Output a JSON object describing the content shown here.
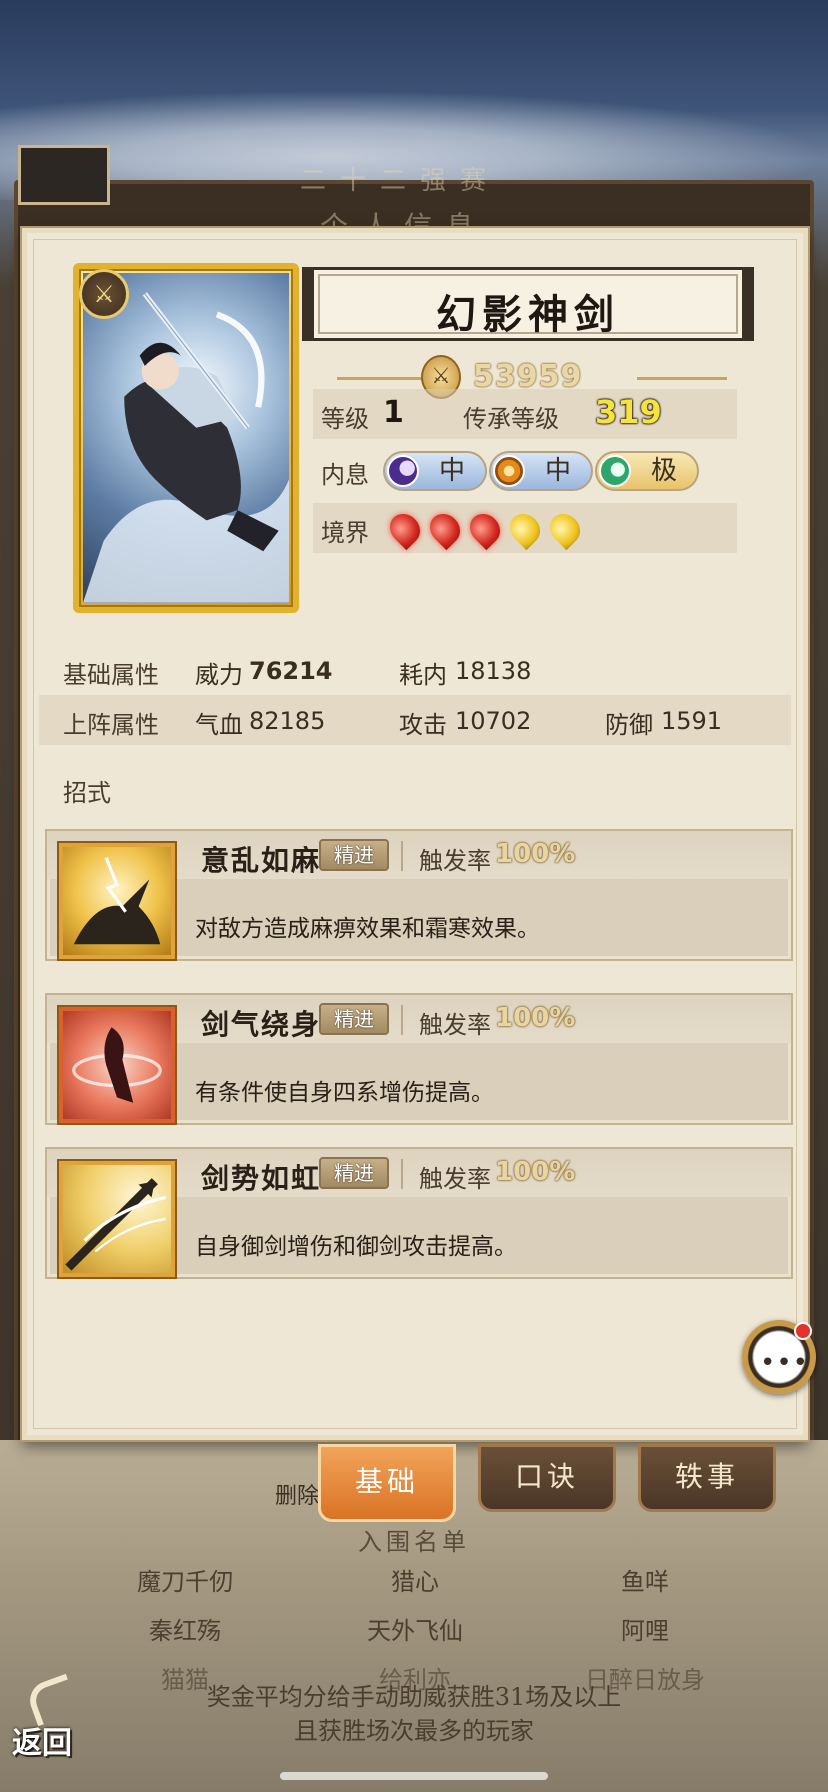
{
  "background": {
    "title": "二十二强赛",
    "subtitle": "个人信息",
    "deleted_label": "删除",
    "list_title": "入围名单",
    "names": [
      "魔刀千仞",
      "猎心",
      "鱼咩",
      "秦红殇",
      "天外飞仙",
      "阿哩",
      "猫猫",
      "给利亦",
      "日醉日放身"
    ],
    "note_line1": "奖金平均分给手动助威获胜31场及以上",
    "note_line2": "且获胜场次最多的玩家",
    "back_label": "返回"
  },
  "hero": {
    "name": "幻影神剑",
    "power": "53959",
    "level_label": "等级",
    "level": "1",
    "inherit_label": "传承等级",
    "inherit_level": "319",
    "inner_label": "内息",
    "inner": [
      {
        "icon": "moon-orb-icon",
        "value": "中"
      },
      {
        "icon": "sun-orb-icon",
        "value": "中"
      },
      {
        "icon": "jade-orb-icon",
        "value": "极"
      }
    ],
    "realm_label": "境界",
    "realm": {
      "red": 3,
      "yellow": 2
    }
  },
  "attributes": {
    "base_label": "基础属性",
    "power_label": "威力",
    "power_value": "76214",
    "cost_label": "耗内",
    "cost_value": "18138",
    "deploy_label": "上阵属性",
    "hp_label": "气血",
    "hp_value": "82185",
    "atk_label": "攻击",
    "atk_value": "10702",
    "def_label": "防御",
    "def_value": "1591"
  },
  "moves_title": "招式",
  "skills": [
    {
      "name": "意乱如麻",
      "tag": "精进",
      "trigger_label": "触发率",
      "trigger": "100%",
      "desc": "对敌方造成麻痹效果和霜寒效果。",
      "icon": "lightning-strike-icon"
    },
    {
      "name": "剑气绕身",
      "tag": "精进",
      "trigger_label": "触发率",
      "trigger": "100%",
      "desc": "有条件使自身四系增伤提高。",
      "icon": "sword-whirl-icon"
    },
    {
      "name": "剑势如虹",
      "tag": "精进",
      "trigger_label": "触发率",
      "trigger": "100%",
      "desc": "自身御剑增伤和御剑攻击提高。",
      "icon": "sword-thrust-icon"
    }
  ],
  "tabs": [
    {
      "label": "基础",
      "active": true
    },
    {
      "label": "口诀",
      "active": false
    },
    {
      "label": "轶事",
      "active": false
    }
  ],
  "colors": {
    "card_bg": "#efe7d5",
    "accent_gold": "#e0b22e",
    "tab_active": "#d97324",
    "realm_red": "#d2261c",
    "realm_yellow": "#f0c41c"
  }
}
